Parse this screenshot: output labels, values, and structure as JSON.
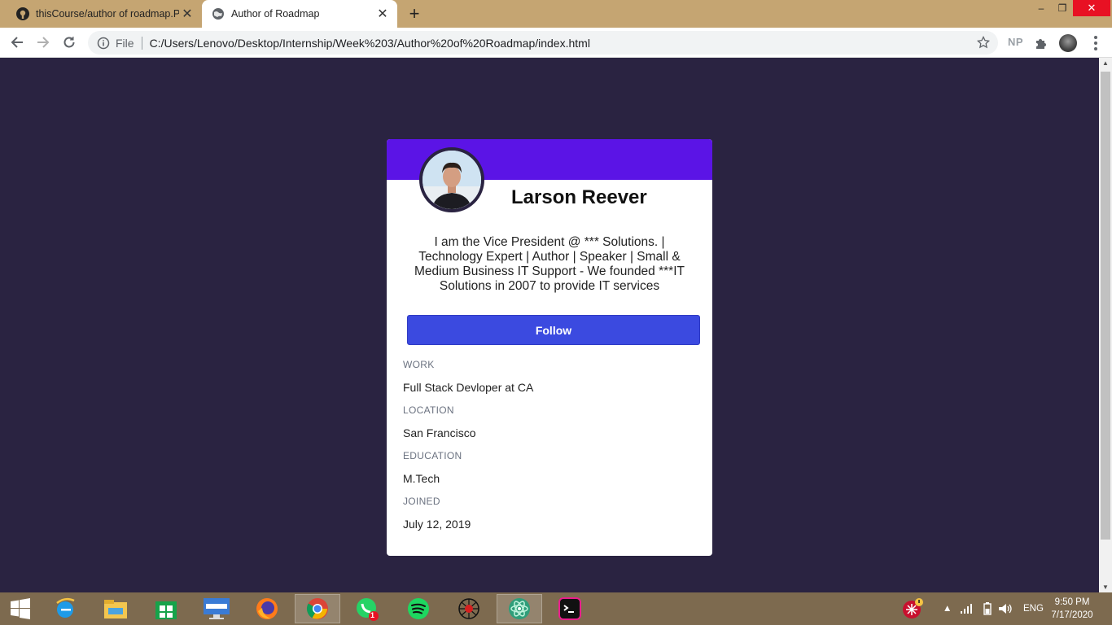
{
  "browser": {
    "tabs": [
      {
        "title": "thisCourse/author of roadmap.PI",
        "icon": "github-icon",
        "active": false
      },
      {
        "title": "Author of Roadmap",
        "icon": "globe-icon",
        "active": true
      }
    ],
    "address_bar": {
      "scheme": "File",
      "url": "C:/Users/Lenovo/Desktop/Internship/Week%203/Author%20of%20Roadmap/index.html"
    },
    "profile_initials": "NP"
  },
  "profile": {
    "name": "Larson Reever",
    "bio": "I am the Vice President @ *** Solutions. | Technology Expert | Author | Speaker | Small & Medium Business IT Support - We founded ***IT Solutions in 2007 to provide IT services",
    "follow_label": "Follow",
    "details": [
      {
        "label": "WORK",
        "value": "Full Stack Devloper at CA"
      },
      {
        "label": "LOCATION",
        "value": "San Francisco"
      },
      {
        "label": "EDUCATION",
        "value": "M.Tech"
      },
      {
        "label": "JOINED",
        "value": "July 12, 2019"
      }
    ],
    "colors": {
      "header": "#5b14e6",
      "button": "#3b4ae0",
      "background": "#2a2341"
    }
  },
  "taskbar": {
    "apps": [
      "windows-start-icon",
      "internet-explorer-icon",
      "file-explorer-icon",
      "store-icon",
      "lenovo-icon",
      "firefox-icon",
      "chrome-icon",
      "whatsapp-icon",
      "spotify-icon",
      "web-icon",
      "atom-icon",
      "terminal-icon"
    ],
    "whatsapp_badge": "1",
    "language": "ENG",
    "time": "9:50 PM",
    "date": "7/17/2020"
  }
}
